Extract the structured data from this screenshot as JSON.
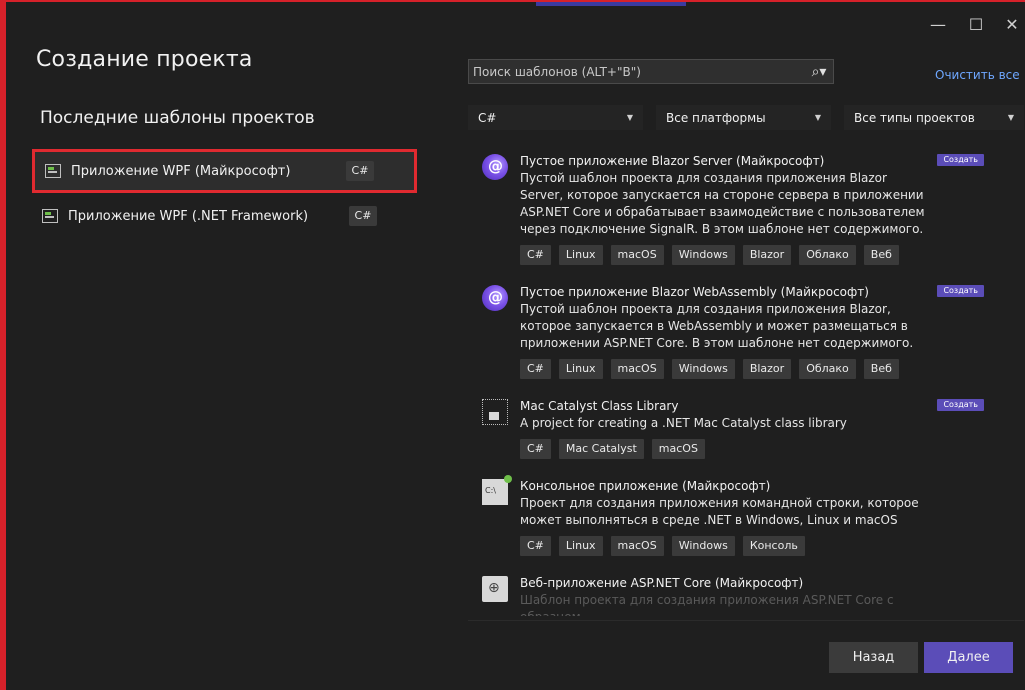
{
  "window": {
    "title": "Создание проекта",
    "controls": {
      "minimize": "—",
      "maximize": "☐",
      "close": "✕"
    }
  },
  "recent": {
    "heading": "Последние шаблоны проектов",
    "items": [
      {
        "label": "Приложение WPF (Майкрософт)",
        "lang": "C#",
        "selected": true
      },
      {
        "label": "Приложение WPF (.NET Framework)",
        "lang": "C#",
        "selected": false
      }
    ]
  },
  "search": {
    "placeholder": "Поиск шаблонов (ALT+\"В\")",
    "icon": "search-icon",
    "clear_label": "Очистить все"
  },
  "filters": {
    "language": "C#",
    "platform": "Все платформы",
    "project_type": "Все типы проектов"
  },
  "templates": [
    {
      "icon": "blazor-icon",
      "title": "Пустое приложение Blazor Server (Майкрософт)",
      "description": "Пустой шаблон проекта для создания приложения Blazor Server, которое запускается на стороне сервера в приложении ASP.NET Core и обрабатывает взаимодействие с пользователем через подключение SignalR. В этом шаблоне нет содержимого.",
      "tags": [
        "C#",
        "Linux",
        "macOS",
        "Windows",
        "Blazor",
        "Облако",
        "Веб"
      ],
      "badge": "Создать"
    },
    {
      "icon": "blazor-icon",
      "title": "Пустое приложение Blazor WebAssembly (Майкрософт)",
      "description": "Пустой шаблон проекта для создания приложения Blazor, которое запускается в WebAssembly и может размещаться в приложении ASP.NET Core. В этом шаблоне нет содержимого.",
      "tags": [
        "C#",
        "Linux",
        "macOS",
        "Windows",
        "Blazor",
        "Облако",
        "Веб"
      ],
      "badge": "Создать"
    },
    {
      "icon": "library-icon",
      "title": "Mac Catalyst Class Library",
      "description": "A project for creating a .NET Mac Catalyst class library",
      "tags": [
        "C#",
        "Mac Catalyst",
        "macOS"
      ],
      "badge": "Создать"
    },
    {
      "icon": "console-icon",
      "title": "Консольное приложение (Майкрософт)",
      "description": "Проект для создания приложения командной строки, которое может выполняться в среде .NET в Windows, Linux и macOS",
      "tags": [
        "C#",
        "Linux",
        "macOS",
        "Windows",
        "Консоль"
      ],
      "badge": ""
    },
    {
      "icon": "web-app-icon",
      "title": "Веб-приложение ASP.NET Core (Майкрософт)",
      "description": "Шаблон проекта для создания приложения ASP.NET Core с образцом",
      "tags": [],
      "badge": ""
    }
  ],
  "footer": {
    "back_label": "Назад",
    "next_label": "Далее"
  },
  "colors": {
    "background": "#1f1f1f",
    "accent": "#5b4db8",
    "highlight_border": "#e02a30",
    "link": "#6ea7ff"
  }
}
